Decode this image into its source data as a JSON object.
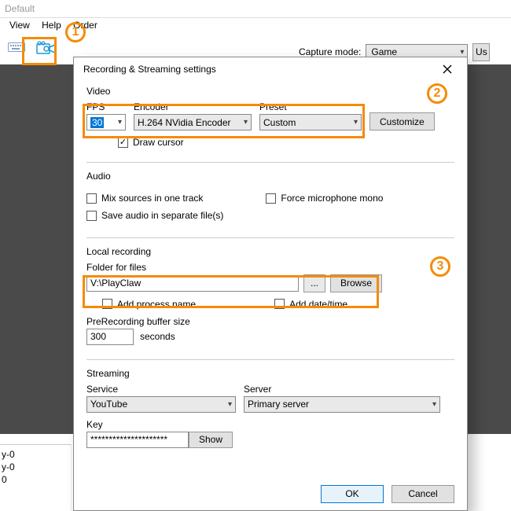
{
  "bg": {
    "title": "Default",
    "menu": {
      "view": "View",
      "help": "Help",
      "order": "Order"
    },
    "capture_mode_label": "Capture mode:",
    "capture_mode_value": "Game",
    "user_btn_fragment": "Us",
    "list_items": [
      "y-0",
      "y-0",
      "0"
    ]
  },
  "dialog": {
    "title": "Recording & Streaming settings",
    "video": {
      "section": "Video",
      "fps_label": "FPS",
      "fps_value": "30",
      "encoder_label": "Encoder",
      "encoder_value": "H.264 NVidia Encoder",
      "preset_label": "Preset",
      "preset_value": "Custom",
      "customize_btn": "Customize",
      "draw_cursor": "Draw cursor"
    },
    "audio": {
      "section": "Audio",
      "mix": "Mix sources in one track",
      "force_mono": "Force microphone mono",
      "save_sep": "Save audio in separate file(s)"
    },
    "local": {
      "section": "Local recording",
      "folder_label": "Folder for files",
      "folder_value": "V:\\PlayClaw",
      "ellipsis": "...",
      "browse": "Browse",
      "add_process": "Add process name",
      "add_datetime": "Add date/time",
      "prerec_label": "PreRecording buffer size",
      "prerec_value": "300",
      "seconds": "seconds"
    },
    "stream": {
      "section": "Streaming",
      "service_label": "Service",
      "service_value": "YouTube",
      "server_label": "Server",
      "server_value": "Primary server",
      "key_label": "Key",
      "key_value": "*********************",
      "show": "Show"
    },
    "footer": {
      "ok": "OK",
      "cancel": "Cancel"
    }
  },
  "annotations": {
    "one": "1",
    "two": "2",
    "three": "3"
  }
}
